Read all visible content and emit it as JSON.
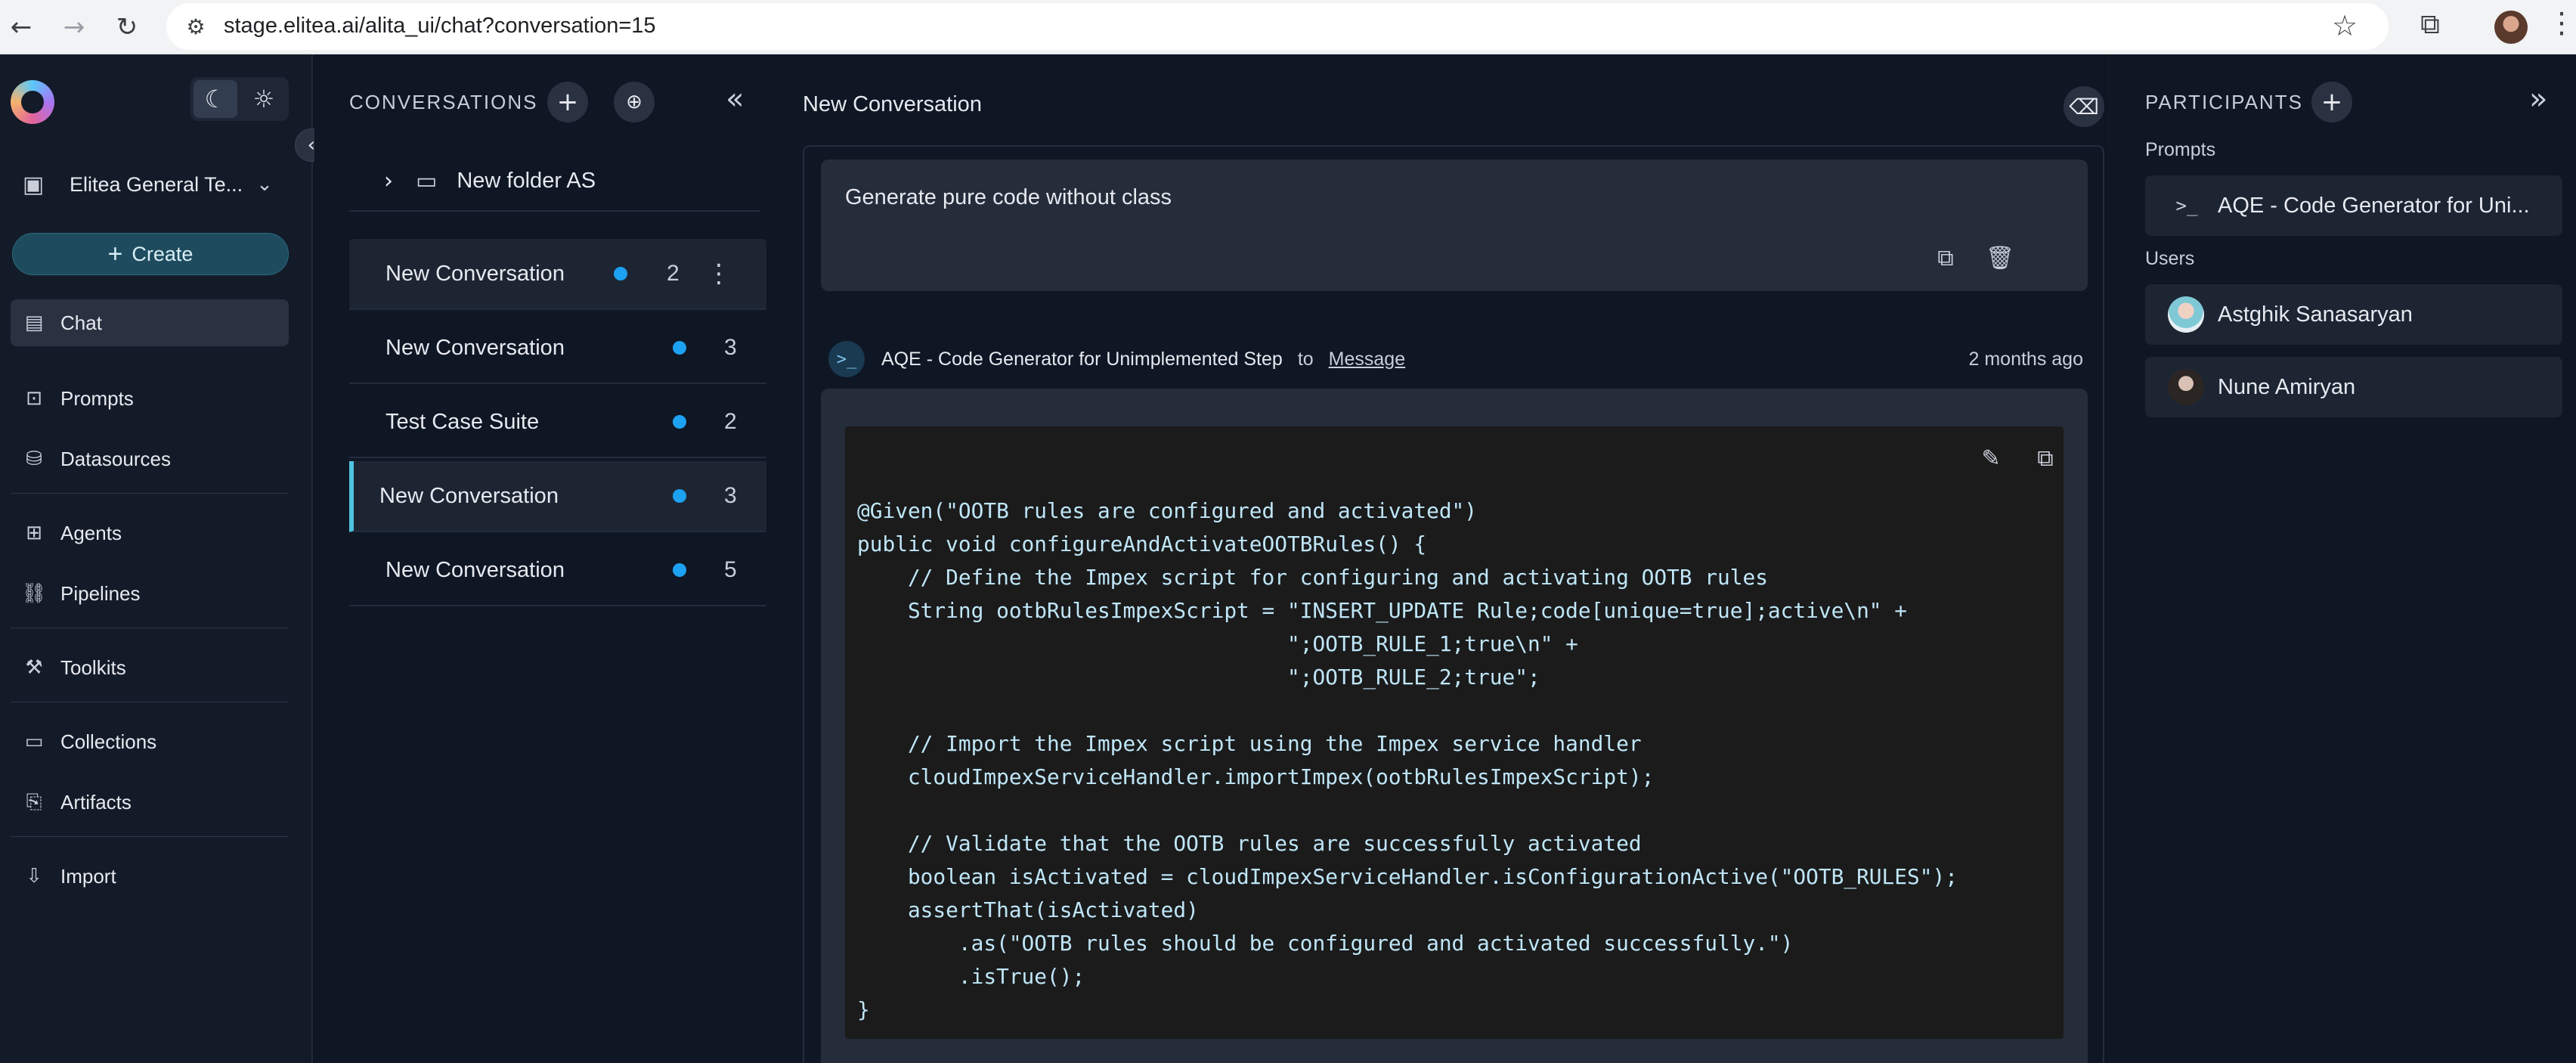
{
  "browser": {
    "back_icon": "arrow-left-icon",
    "forward_icon": "arrow-right-icon",
    "reload_icon": "reload-icon",
    "url": "stage.elitea.ai/alita_ui/chat?conversation=15"
  },
  "sidebar": {
    "project_name": "Elitea General Te...",
    "create_label": "Create",
    "nav": [
      {
        "label": "Chat",
        "icon": "chat-icon",
        "active": true
      },
      {
        "label": "Prompts",
        "icon": "terminal-icon"
      },
      {
        "label": "Datasources",
        "icon": "database-icon"
      },
      {
        "label": "Agents",
        "icon": "grid-icon"
      },
      {
        "label": "Pipelines",
        "icon": "pipeline-icon"
      },
      {
        "label": "Toolkits",
        "icon": "wrench-icon"
      },
      {
        "label": "Collections",
        "icon": "folder-icon"
      },
      {
        "label": "Artifacts",
        "icon": "artifact-icon"
      },
      {
        "label": "Import",
        "icon": "import-icon"
      }
    ]
  },
  "conversations": {
    "title": "CONVERSATIONS",
    "folder": {
      "name": "New folder AS"
    },
    "items": [
      {
        "name": "New Conversation",
        "count": "2",
        "state": "hovered"
      },
      {
        "name": "New Conversation",
        "count": "3"
      },
      {
        "name": "Test Case Suite",
        "count": "2"
      },
      {
        "name": "New Conversation",
        "count": "3",
        "state": "selected"
      },
      {
        "name": "New Conversation",
        "count": "5"
      }
    ],
    "dot_color": "#1da1f2"
  },
  "chat": {
    "title": "New Conversation",
    "user_message": "Generate pure code without class",
    "bot": {
      "name": "AQE - Code Generator for Unimplemented Step",
      "to": "to",
      "target": "Message",
      "time": "2 months ago"
    },
    "code_lines": [
      "@Given(\"OOTB rules are configured and activated\")",
      "public void configureAndActivateOOTBRules() {",
      "    // Define the Impex script for configuring and activating OOTB rules",
      "    String ootbRulesImpexScript = \"INSERT_UPDATE Rule;code[unique=true];active\\n\" +",
      "                                  \";OOTB_RULE_1;true\\n\" +",
      "                                  \";OOTB_RULE_2;true\";",
      "",
      "    // Import the Impex script using the Impex service handler",
      "    cloudImpexServiceHandler.importImpex(ootbRulesImpexScript);",
      "",
      "    // Validate that the OOTB rules are successfully activated",
      "    boolean isActivated = cloudImpexServiceHandler.isConfigurationActive(\"OOTB_RULES\");",
      "    assertThat(isActivated)",
      "        .as(\"OOTB rules should be configured and activated successfully.\")",
      "        .isTrue();",
      "}"
    ]
  },
  "participants": {
    "title": "PARTICIPANTS",
    "prompts_label": "Prompts",
    "prompt_item": "AQE - Code Generator for Uni...",
    "users_label": "Users",
    "users": [
      "Astghik Sanasaryan",
      "Nune Amiryan"
    ]
  },
  "colors": {
    "accent": "#4fc3e0",
    "background": "#0f1624",
    "card": "#252c3a"
  }
}
